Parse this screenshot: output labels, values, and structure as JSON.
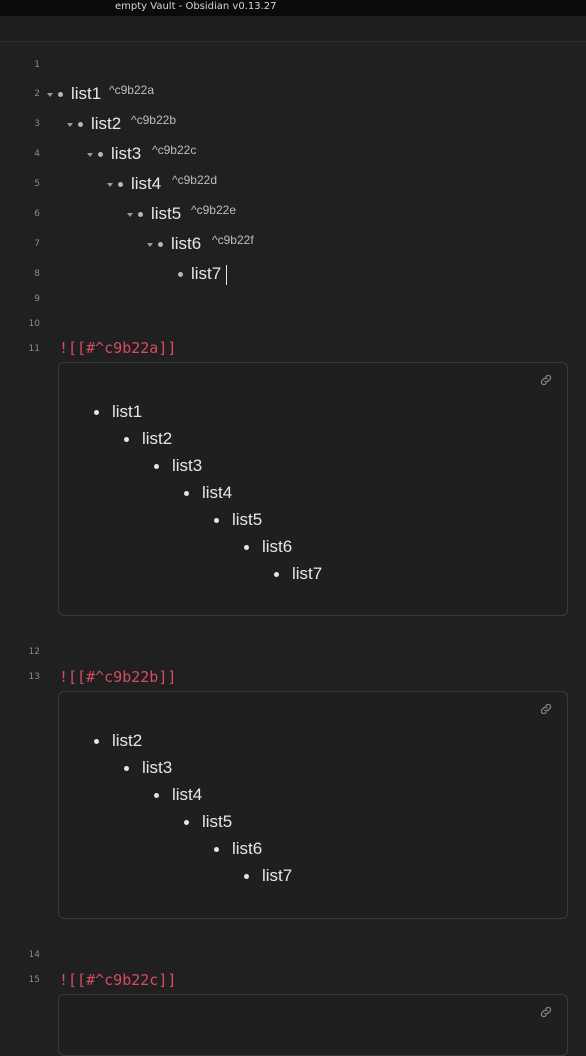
{
  "window": {
    "title": "empty Vault - Obsidian v0.13.27"
  },
  "editor": {
    "line_numbers": [
      "1",
      "2",
      "3",
      "4",
      "5",
      "6",
      "7",
      "8",
      "9",
      "10",
      "11",
      "12",
      "13",
      "14",
      "15"
    ],
    "list": [
      {
        "text": "list1",
        "block_id": "^c9b22a"
      },
      {
        "text": "list2",
        "block_id": "^c9b22b"
      },
      {
        "text": "list3",
        "block_id": "^c9b22c"
      },
      {
        "text": "list4",
        "block_id": "^c9b22d"
      },
      {
        "text": "list5",
        "block_id": "^c9b22e"
      },
      {
        "text": "list6",
        "block_id": "^c9b22f"
      },
      {
        "text": "list7",
        "block_id": ""
      }
    ],
    "embeds": [
      {
        "code": "![[#^c9b22a]]",
        "items": [
          "list1",
          "list2",
          "list3",
          "list4",
          "list5",
          "list6",
          "list7"
        ]
      },
      {
        "code": "![[#^c9b22b]]",
        "items": [
          "list2",
          "list3",
          "list4",
          "list5",
          "list6",
          "list7"
        ]
      },
      {
        "code": "![[#^c9b22c]]",
        "items": []
      }
    ]
  },
  "icons": {
    "embed_link": "link-icon",
    "fold": "chevron-down-icon",
    "bullet": "bullet-icon"
  }
}
